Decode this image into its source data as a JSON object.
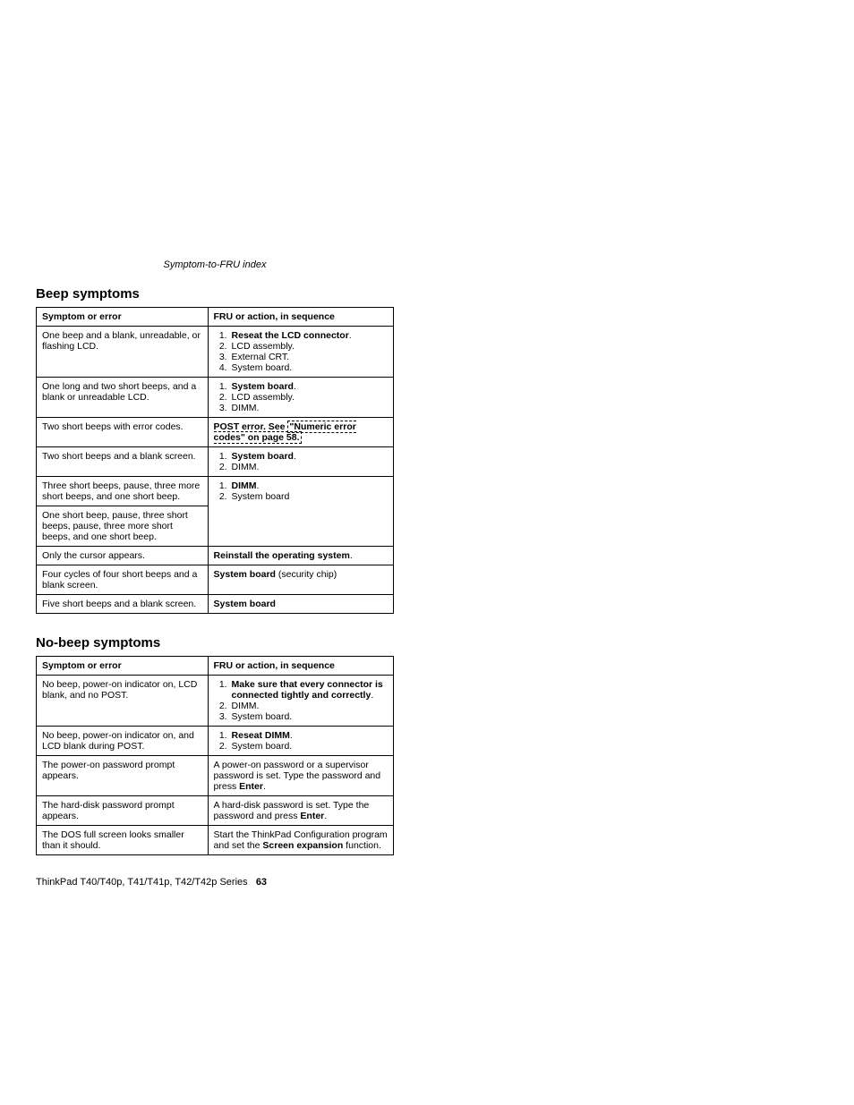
{
  "running_head": "Symptom-to-FRU index",
  "section1_title": "Beep symptoms",
  "section2_title": "No-beep symptoms",
  "th_symptom": "Symptom or error",
  "th_fru": "FRU or action, in sequence",
  "beep": {
    "r1_sym": "One beep and a blank, unreadable, or flashing LCD.",
    "r1_li1_b": "Reseat the LCD connector",
    "r1_li2": "LCD assembly.",
    "r1_li3": "External CRT.",
    "r1_li4": "System board.",
    "r2_sym": "One long and two short beeps, and a blank or unreadable LCD.",
    "r2_li1_b": "System board",
    "r2_li2": "LCD assembly.",
    "r2_li3": "DIMM.",
    "r3_sym": "Two short beeps with error codes.",
    "r3_fru_b": "POST error. See ",
    "r3_fru_link": "\"Numeric error codes\" on page 58.",
    "r4_sym": "Two short beeps and a blank screen.",
    "r4_li1_b": "System board",
    "r4_li2": "DIMM.",
    "r5_sym": "Three short beeps, pause, three more short beeps, and one short beep.",
    "r5_li1_b": "DIMM",
    "r5_li2": "System board",
    "r6_sym": "One short beep, pause, three short beeps, pause, three more short beeps, and one short beep.",
    "r7_sym": "Only the cursor appears.",
    "r7_fru_b": "Reinstall the operating system",
    "r8_sym": "Four cycles of four short beeps and a blank screen.",
    "r8_fru_b": "System board",
    "r8_fru_rest": " (security chip)",
    "r9_sym": "Five short beeps and a blank screen.",
    "r9_fru_b": "System board"
  },
  "nobeep": {
    "r1_sym": "No beep, power-on indicator on, LCD blank, and no POST.",
    "r1_li1_b": "Make sure that every connector is connected tightly and correctly",
    "r1_li2": "DIMM.",
    "r1_li3": "System board.",
    "r2_sym": "No beep, power-on indicator on, and LCD blank during POST.",
    "r2_li1_b": "Reseat DIMM",
    "r2_li2": "System board.",
    "r3_sym": "The power-on password prompt appears.",
    "r3_fru_pre": "A power-on password or a supervisor password is set. Type the password and press ",
    "r3_fru_b": "Enter",
    "r4_sym": "The hard-disk password prompt appears.",
    "r4_fru_pre": "A hard-disk password is set. Type the password and press ",
    "r4_fru_b": "Enter",
    "r5_sym": "The DOS full screen looks smaller than it should.",
    "r5_fru_pre": "Start the ThinkPad Configuration program and set the ",
    "r5_fru_b": "Screen expansion",
    "r5_fru_post": " function."
  },
  "footer_text": "ThinkPad T40/T40p, T41/T41p, T42/T42p Series",
  "footer_page": "63"
}
